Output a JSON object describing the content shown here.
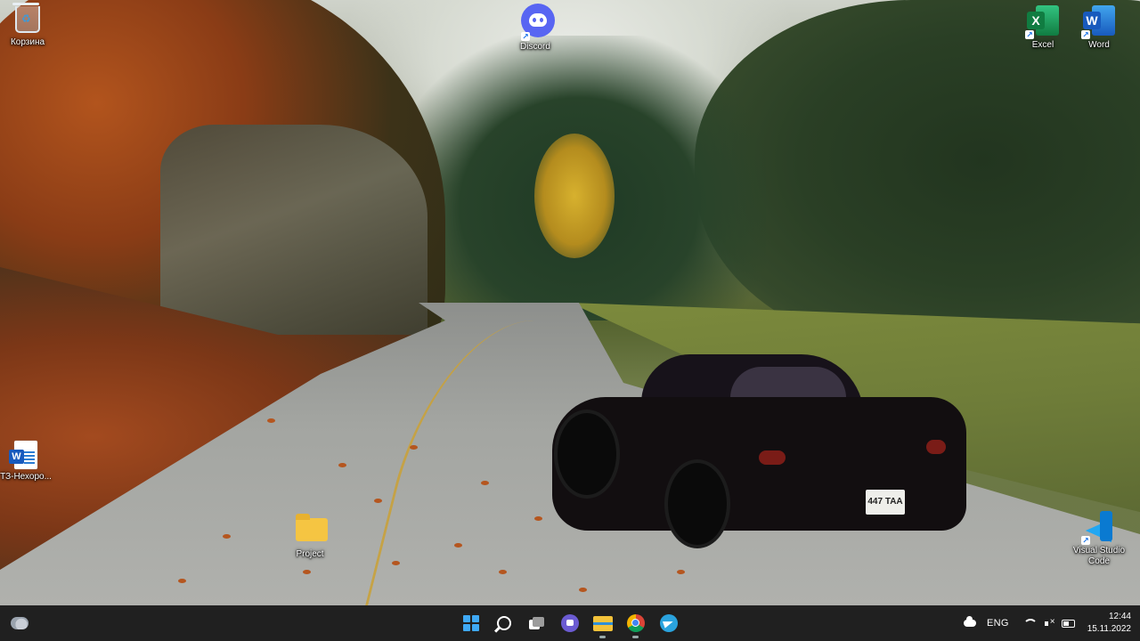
{
  "desktop": {
    "icons": {
      "recycle_bin": {
        "label": "Корзина"
      },
      "discord": {
        "label": "Discord"
      },
      "excel": {
        "label": "Excel"
      },
      "word": {
        "label": "Word"
      },
      "document": {
        "label": "ТЗ-Нехоро..."
      },
      "project_folder": {
        "label": "Project"
      },
      "vscode": {
        "label": "Visual Studio Code"
      }
    },
    "license_plate": "447 TAA"
  },
  "taskbar": {
    "pinned": [
      {
        "name": "Start",
        "icon": "windows-logo-icon"
      },
      {
        "name": "Search",
        "icon": "search-icon"
      },
      {
        "name": "Task View",
        "icon": "task-view-icon"
      },
      {
        "name": "Chat",
        "icon": "chat-icon"
      },
      {
        "name": "File Explorer",
        "icon": "folder-icon",
        "active": true
      },
      {
        "name": "Google Chrome",
        "icon": "chrome-icon",
        "active": true
      },
      {
        "name": "Telegram",
        "icon": "telegram-icon"
      }
    ],
    "tray": {
      "language": "ENG",
      "time": "12:44",
      "date": "15.11.2022"
    }
  },
  "colors": {
    "taskbar_bg": "#202020",
    "discord": "#5865f2",
    "excel": "#107c41",
    "word": "#185abd",
    "vscode": "#0a7ad1",
    "folder": "#f5c542"
  }
}
